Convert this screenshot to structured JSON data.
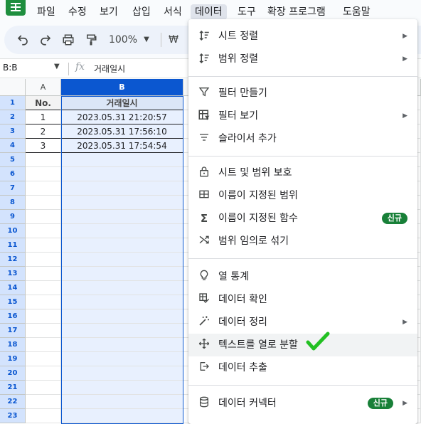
{
  "menubar": {
    "items": [
      "파일",
      "수정",
      "보기",
      "삽입",
      "서식",
      "데이터",
      "도구",
      "확장 프로그램",
      "도움말"
    ],
    "active": "데이터"
  },
  "toolbar": {
    "zoom": "100%",
    "currency": "₩"
  },
  "formula_bar": {
    "name_box": "B:B",
    "fx": "fx",
    "value": "거래일시"
  },
  "grid": {
    "columns": [
      "A",
      "B"
    ],
    "row_numbers": [
      "1",
      "2",
      "3",
      "4",
      "5",
      "6",
      "7",
      "8",
      "9",
      "10",
      "11",
      "12",
      "13",
      "14",
      "15",
      "16",
      "17",
      "18",
      "19",
      "20",
      "21",
      "22",
      "23"
    ],
    "header_row": [
      "No.",
      "거래일시"
    ],
    "rows": [
      [
        "1",
        "2023.05.31 21:20:57"
      ],
      [
        "2",
        "2023.05.31 17:56:10"
      ],
      [
        "3",
        "2023.05.31 17:54:54"
      ]
    ]
  },
  "data_menu": {
    "sort_sheet": "시트 정렬",
    "sort_range": "범위 정렬",
    "create_filter": "필터 만들기",
    "filter_views": "필터 보기",
    "add_slicer": "슬라이서 추가",
    "protect": "시트 및 범위 보호",
    "named_ranges": "이름이 지정된 범위",
    "named_functions": "이름이 지정된 함수",
    "randomize": "범위 임의로 섞기",
    "column_stats": "열 통계",
    "data_validation": "데이터 확인",
    "data_cleanup": "데이터 정리",
    "split_text": "텍스트를 열로 분할",
    "data_extraction": "데이터 추출",
    "data_connectors": "데이터 커넥터",
    "new_badge": "신규"
  },
  "colors": {
    "accent": "#0b57d0",
    "badge": "#188038",
    "checkmark": "#22c022"
  }
}
